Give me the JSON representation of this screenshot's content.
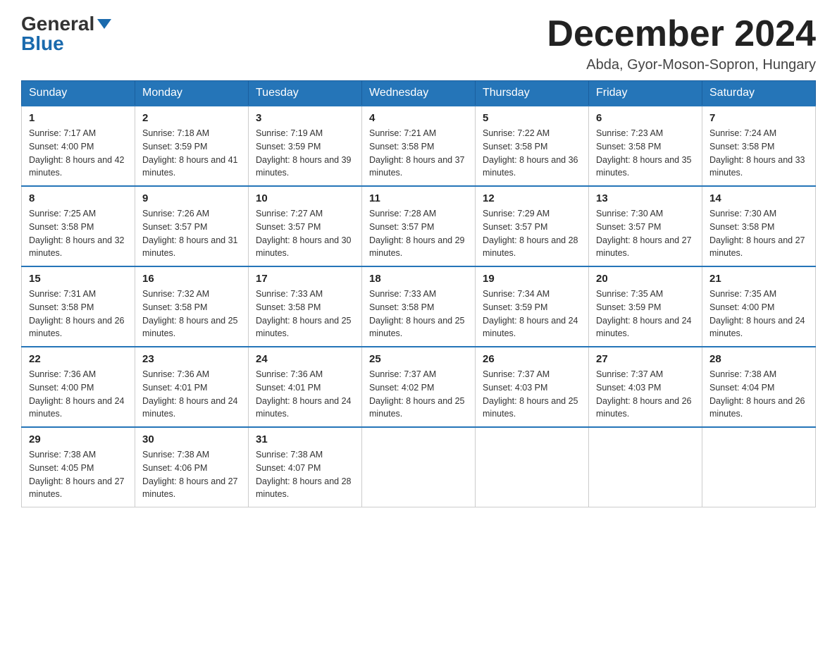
{
  "header": {
    "logo_general": "General",
    "logo_blue": "Blue",
    "title": "December 2024",
    "location": "Abda, Gyor-Moson-Sopron, Hungary"
  },
  "columns": [
    "Sunday",
    "Monday",
    "Tuesday",
    "Wednesday",
    "Thursday",
    "Friday",
    "Saturday"
  ],
  "weeks": [
    [
      {
        "day": "1",
        "sunrise": "Sunrise: 7:17 AM",
        "sunset": "Sunset: 4:00 PM",
        "daylight": "Daylight: 8 hours and 42 minutes."
      },
      {
        "day": "2",
        "sunrise": "Sunrise: 7:18 AM",
        "sunset": "Sunset: 3:59 PM",
        "daylight": "Daylight: 8 hours and 41 minutes."
      },
      {
        "day": "3",
        "sunrise": "Sunrise: 7:19 AM",
        "sunset": "Sunset: 3:59 PM",
        "daylight": "Daylight: 8 hours and 39 minutes."
      },
      {
        "day": "4",
        "sunrise": "Sunrise: 7:21 AM",
        "sunset": "Sunset: 3:58 PM",
        "daylight": "Daylight: 8 hours and 37 minutes."
      },
      {
        "day": "5",
        "sunrise": "Sunrise: 7:22 AM",
        "sunset": "Sunset: 3:58 PM",
        "daylight": "Daylight: 8 hours and 36 minutes."
      },
      {
        "day": "6",
        "sunrise": "Sunrise: 7:23 AM",
        "sunset": "Sunset: 3:58 PM",
        "daylight": "Daylight: 8 hours and 35 minutes."
      },
      {
        "day": "7",
        "sunrise": "Sunrise: 7:24 AM",
        "sunset": "Sunset: 3:58 PM",
        "daylight": "Daylight: 8 hours and 33 minutes."
      }
    ],
    [
      {
        "day": "8",
        "sunrise": "Sunrise: 7:25 AM",
        "sunset": "Sunset: 3:58 PM",
        "daylight": "Daylight: 8 hours and 32 minutes."
      },
      {
        "day": "9",
        "sunrise": "Sunrise: 7:26 AM",
        "sunset": "Sunset: 3:57 PM",
        "daylight": "Daylight: 8 hours and 31 minutes."
      },
      {
        "day": "10",
        "sunrise": "Sunrise: 7:27 AM",
        "sunset": "Sunset: 3:57 PM",
        "daylight": "Daylight: 8 hours and 30 minutes."
      },
      {
        "day": "11",
        "sunrise": "Sunrise: 7:28 AM",
        "sunset": "Sunset: 3:57 PM",
        "daylight": "Daylight: 8 hours and 29 minutes."
      },
      {
        "day": "12",
        "sunrise": "Sunrise: 7:29 AM",
        "sunset": "Sunset: 3:57 PM",
        "daylight": "Daylight: 8 hours and 28 minutes."
      },
      {
        "day": "13",
        "sunrise": "Sunrise: 7:30 AM",
        "sunset": "Sunset: 3:57 PM",
        "daylight": "Daylight: 8 hours and 27 minutes."
      },
      {
        "day": "14",
        "sunrise": "Sunrise: 7:30 AM",
        "sunset": "Sunset: 3:58 PM",
        "daylight": "Daylight: 8 hours and 27 minutes."
      }
    ],
    [
      {
        "day": "15",
        "sunrise": "Sunrise: 7:31 AM",
        "sunset": "Sunset: 3:58 PM",
        "daylight": "Daylight: 8 hours and 26 minutes."
      },
      {
        "day": "16",
        "sunrise": "Sunrise: 7:32 AM",
        "sunset": "Sunset: 3:58 PM",
        "daylight": "Daylight: 8 hours and 25 minutes."
      },
      {
        "day": "17",
        "sunrise": "Sunrise: 7:33 AM",
        "sunset": "Sunset: 3:58 PM",
        "daylight": "Daylight: 8 hours and 25 minutes."
      },
      {
        "day": "18",
        "sunrise": "Sunrise: 7:33 AM",
        "sunset": "Sunset: 3:58 PM",
        "daylight": "Daylight: 8 hours and 25 minutes."
      },
      {
        "day": "19",
        "sunrise": "Sunrise: 7:34 AM",
        "sunset": "Sunset: 3:59 PM",
        "daylight": "Daylight: 8 hours and 24 minutes."
      },
      {
        "day": "20",
        "sunrise": "Sunrise: 7:35 AM",
        "sunset": "Sunset: 3:59 PM",
        "daylight": "Daylight: 8 hours and 24 minutes."
      },
      {
        "day": "21",
        "sunrise": "Sunrise: 7:35 AM",
        "sunset": "Sunset: 4:00 PM",
        "daylight": "Daylight: 8 hours and 24 minutes."
      }
    ],
    [
      {
        "day": "22",
        "sunrise": "Sunrise: 7:36 AM",
        "sunset": "Sunset: 4:00 PM",
        "daylight": "Daylight: 8 hours and 24 minutes."
      },
      {
        "day": "23",
        "sunrise": "Sunrise: 7:36 AM",
        "sunset": "Sunset: 4:01 PM",
        "daylight": "Daylight: 8 hours and 24 minutes."
      },
      {
        "day": "24",
        "sunrise": "Sunrise: 7:36 AM",
        "sunset": "Sunset: 4:01 PM",
        "daylight": "Daylight: 8 hours and 24 minutes."
      },
      {
        "day": "25",
        "sunrise": "Sunrise: 7:37 AM",
        "sunset": "Sunset: 4:02 PM",
        "daylight": "Daylight: 8 hours and 25 minutes."
      },
      {
        "day": "26",
        "sunrise": "Sunrise: 7:37 AM",
        "sunset": "Sunset: 4:03 PM",
        "daylight": "Daylight: 8 hours and 25 minutes."
      },
      {
        "day": "27",
        "sunrise": "Sunrise: 7:37 AM",
        "sunset": "Sunset: 4:03 PM",
        "daylight": "Daylight: 8 hours and 26 minutes."
      },
      {
        "day": "28",
        "sunrise": "Sunrise: 7:38 AM",
        "sunset": "Sunset: 4:04 PM",
        "daylight": "Daylight: 8 hours and 26 minutes."
      }
    ],
    [
      {
        "day": "29",
        "sunrise": "Sunrise: 7:38 AM",
        "sunset": "Sunset: 4:05 PM",
        "daylight": "Daylight: 8 hours and 27 minutes."
      },
      {
        "day": "30",
        "sunrise": "Sunrise: 7:38 AM",
        "sunset": "Sunset: 4:06 PM",
        "daylight": "Daylight: 8 hours and 27 minutes."
      },
      {
        "day": "31",
        "sunrise": "Sunrise: 7:38 AM",
        "sunset": "Sunset: 4:07 PM",
        "daylight": "Daylight: 8 hours and 28 minutes."
      },
      {
        "day": "",
        "sunrise": "",
        "sunset": "",
        "daylight": ""
      },
      {
        "day": "",
        "sunrise": "",
        "sunset": "",
        "daylight": ""
      },
      {
        "day": "",
        "sunrise": "",
        "sunset": "",
        "daylight": ""
      },
      {
        "day": "",
        "sunrise": "",
        "sunset": "",
        "daylight": ""
      }
    ]
  ]
}
